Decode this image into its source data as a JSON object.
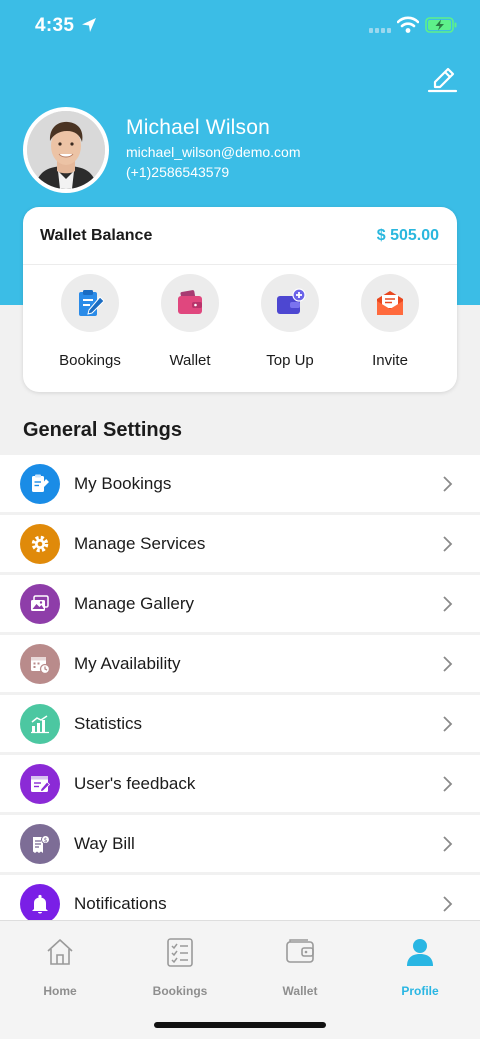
{
  "status": {
    "time": "4:35"
  },
  "profile": {
    "name": "Michael Wilson",
    "email": "michael_wilson@demo.com",
    "phone": "(+1)2586543579"
  },
  "wallet": {
    "label": "Wallet Balance",
    "amount": "$ 505.00",
    "actions": [
      {
        "label": "Bookings",
        "icon": "clipboard-pen-icon"
      },
      {
        "label": "Wallet",
        "icon": "wallet-icon"
      },
      {
        "label": "Top Up",
        "icon": "card-add-icon"
      },
      {
        "label": "Invite",
        "icon": "envelope-icon"
      }
    ]
  },
  "settings": {
    "title": "General Settings",
    "items": [
      {
        "label": "My Bookings",
        "icon": "clipboard-pen-icon",
        "color": "#1a8ce6"
      },
      {
        "label": "Manage Services",
        "icon": "gear-icon",
        "color": "#e08a0a"
      },
      {
        "label": "Manage Gallery",
        "icon": "gallery-icon",
        "color": "#8e3da9"
      },
      {
        "label": "My Availability",
        "icon": "calendar-clock-icon",
        "color": "#b98b8b"
      },
      {
        "label": "Statistics",
        "icon": "bar-chart-icon",
        "color": "#4cc7a1"
      },
      {
        "label": "User's feedback",
        "icon": "feedback-icon",
        "color": "#8b2ad6"
      },
      {
        "label": "Way Bill",
        "icon": "bill-icon",
        "color": "#7d6d96"
      },
      {
        "label": "Notifications",
        "icon": "bell-icon",
        "color": "#7a1fe6"
      }
    ]
  },
  "tabs": [
    {
      "label": "Home",
      "icon": "home-icon",
      "active": false
    },
    {
      "label": "Bookings",
      "icon": "checklist-icon",
      "active": false
    },
    {
      "label": "Wallet",
      "icon": "wallet-icon",
      "active": false
    },
    {
      "label": "Profile",
      "icon": "person-icon",
      "active": true
    }
  ],
  "colors": {
    "accent": "#3bbde6",
    "active_tab": "#29b6e3",
    "amount": "#2ab7de"
  }
}
